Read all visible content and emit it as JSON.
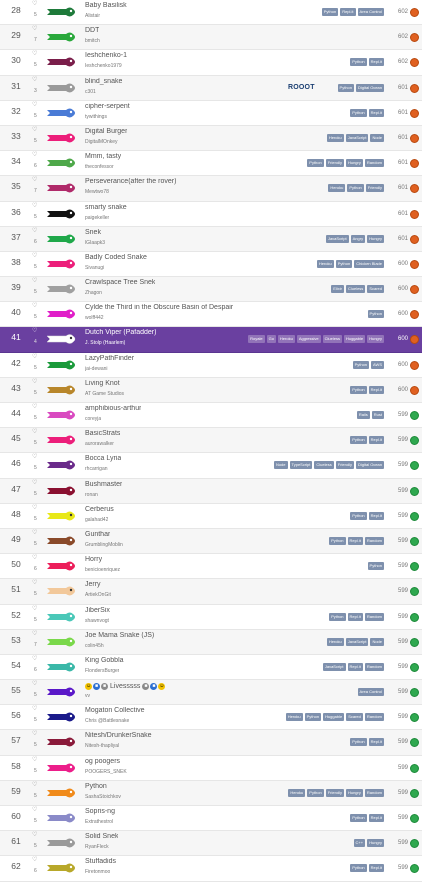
{
  "rows": [
    {
      "rank": "28",
      "hearts": "5",
      "name": "Baby Basilisk",
      "author": "Alistair",
      "tags": [
        "Python",
        "Repl.it",
        "Area Control"
      ],
      "score": "602",
      "badge": "bronze",
      "color": "#1e7a3a"
    },
    {
      "rank": "29",
      "hearts": "7",
      "name": "DDT",
      "author": "bmitch",
      "tags": [],
      "score": "602",
      "badge": "bronze",
      "color": "#29a83b"
    },
    {
      "rank": "30",
      "hearts": "5",
      "name": "Ieshchenko-1",
      "author": "Ieshchenko1979",
      "tags": [
        "Python",
        "Repl.it"
      ],
      "score": "602",
      "badge": "bronze",
      "color": "#7a1e4a"
    },
    {
      "rank": "31",
      "hearts": "3",
      "name": "blind_snake",
      "author": "c301",
      "tags": [
        "Python",
        "Digital Ocean"
      ],
      "score": "601",
      "badge": "bronze",
      "color": "#9a9a9a",
      "logo": "ROOOT"
    },
    {
      "rank": "32",
      "hearts": "5",
      "name": "cipher-serpent",
      "author": "tywithings",
      "tags": [
        "Python",
        "Repl.it"
      ],
      "score": "601",
      "badge": "bronze",
      "color": "#4a7bd6"
    },
    {
      "rank": "33",
      "hearts": "5",
      "name": "Digital Burger",
      "author": "DigitalMOnkey",
      "tags": [
        "Heroku",
        "JavaScript",
        "Node"
      ],
      "score": "601",
      "badge": "bronze",
      "color": "#ec1e7a"
    },
    {
      "rank": "34",
      "hearts": "6",
      "name": "Mmm, tasty",
      "author": "theconfessor",
      "tags": [
        "Python",
        "Friendly",
        "Hungry",
        "Random"
      ],
      "score": "601",
      "badge": "bronze",
      "color": "#4ea84a"
    },
    {
      "rank": "35",
      "hearts": "7",
      "name": "Perseverance(after the rover)",
      "author": "Mewtwo78",
      "tags": [
        "Heroku",
        "Python",
        "Friendly"
      ],
      "score": "601",
      "badge": "bronze",
      "color": "#b02a6a"
    },
    {
      "rank": "36",
      "hearts": "5",
      "name": "smarty snake",
      "author": "paigekeller",
      "tags": [],
      "score": "601",
      "badge": "bronze",
      "color": "#111111"
    },
    {
      "rank": "37",
      "hearts": "6",
      "name": "Snek",
      "author": "lGIaapk3",
      "tags": [
        "JavaScript",
        "Angry",
        "Hungry"
      ],
      "score": "601",
      "badge": "bronze",
      "color": "#1fa84a"
    },
    {
      "rank": "38",
      "hearts": "5",
      "name": "Badly Coded Snake",
      "author": "Sivanugi",
      "tags": [
        "Heroku",
        "Python",
        "Chicken Blade"
      ],
      "score": "600",
      "badge": "bronze",
      "color": "#ec1e7a"
    },
    {
      "rank": "39",
      "hearts": "5",
      "name": "Crawlspace Tree Snek",
      "author": "Zhagon",
      "tags": [
        "Elixir",
        "Clueless",
        "Scared"
      ],
      "score": "600",
      "badge": "bronze",
      "color": "#a0a0a0"
    },
    {
      "rank": "40",
      "hearts": "5",
      "name": "Cylde the Third in the Obscure Basin of Despair",
      "author": "wolff442",
      "tags": [
        "Python"
      ],
      "score": "600",
      "badge": "bronze",
      "color": "#e01ec8"
    },
    {
      "rank": "41",
      "hearts": "4",
      "name": "Dutch Viper (Pafadder)",
      "author": "J. Stolp (Haarlem)",
      "tags": [
        "Royale",
        "Go",
        "Heroku",
        "Aggressive",
        "Clueless",
        "Huggable",
        "Hungry"
      ],
      "score": "600",
      "badge": "bronze",
      "color": "#ffffff",
      "highlight": true
    },
    {
      "rank": "42",
      "hearts": "5",
      "name": "LazyPathFinder",
      "author": "jai-dewani",
      "tags": [
        "Python",
        "AWS"
      ],
      "score": "600",
      "badge": "bronze",
      "color": "#1a9a3a"
    },
    {
      "rank": "43",
      "hearts": "5",
      "name": "Living Knot",
      "author": "AT Game Studios",
      "tags": [
        "Python",
        "Repl.it"
      ],
      "score": "600",
      "badge": "bronze",
      "color": "#b8862a"
    },
    {
      "rank": "44",
      "hearts": "5",
      "name": "amphibious-arthur",
      "author": "coreyja",
      "tags": [
        "Rails",
        "Rust"
      ],
      "score": "599",
      "badge": "green",
      "color": "#d94ac0"
    },
    {
      "rank": "45",
      "hearts": "5",
      "name": "BasicStrats",
      "author": "aurorawalker",
      "tags": [
        "Python",
        "Repl.it"
      ],
      "score": "599",
      "badge": "green",
      "color": "#ec1e7a"
    },
    {
      "rank": "46",
      "hearts": "5",
      "name": "Bocca Lyria",
      "author": "rhcarrigan",
      "tags": [
        "Node",
        "TypeScript",
        "Clueless",
        "Friendly",
        "Digital Ocean"
      ],
      "score": "599",
      "badge": "green",
      "color": "#6a2a8a"
    },
    {
      "rank": "47",
      "hearts": "5",
      "name": "Bushmaster",
      "author": "ronan",
      "tags": [],
      "score": "599",
      "badge": "green",
      "color": "#8a1030"
    },
    {
      "rank": "48",
      "hearts": "5",
      "name": "Cerberus",
      "author": "galahad42",
      "tags": [
        "Python",
        "Repl.it"
      ],
      "score": "599",
      "badge": "green",
      "color": "#e8e818"
    },
    {
      "rank": "49",
      "hearts": "5",
      "name": "Gunthar",
      "author": "GrumblingMoblin",
      "tags": [
        "Python",
        "Repl.it",
        "Random"
      ],
      "score": "599",
      "badge": "green",
      "color": "#8a4a2a"
    },
    {
      "rank": "50",
      "hearts": "6",
      "name": "Horry",
      "author": "benicioenriquez",
      "tags": [
        "Python"
      ],
      "score": "599",
      "badge": "green",
      "color": "#ec1e5a"
    },
    {
      "rank": "51",
      "hearts": "5",
      "name": "Jerry",
      "author": "ArtiekOnGit",
      "tags": [],
      "score": "599",
      "badge": "green",
      "color": "#f2c89a"
    },
    {
      "rank": "52",
      "hearts": "5",
      "name": "JiberSix",
      "author": "shawnvogt",
      "tags": [
        "Python",
        "Repl.it",
        "Random"
      ],
      "score": "599",
      "badge": "green",
      "color": "#4ac8b8"
    },
    {
      "rank": "53",
      "hearts": "7",
      "name": "Joe Mama Snake (JS)",
      "author": "colin45h",
      "tags": [
        "Heroku",
        "JavaScript",
        "Node"
      ],
      "score": "599",
      "badge": "green",
      "color": "#7ad84a"
    },
    {
      "rank": "54",
      "hearts": "6",
      "name": "King Gobbla",
      "author": "FlondersBurger",
      "tags": [
        "JavaScript",
        "Repl.it",
        "Random"
      ],
      "score": "599",
      "badge": "green",
      "color": "#3ab8a8"
    },
    {
      "rank": "55",
      "hearts": "5",
      "name": "Livesssss",
      "author": "vv",
      "tags": [
        "Area Control"
      ],
      "score": "599",
      "badge": "green",
      "color": "#5a18c8",
      "special": true
    },
    {
      "rank": "56",
      "hearts": "5",
      "name": "Mogaton Collective",
      "author": "Chris @Battlesnake",
      "tags": [
        "Heroku",
        "Python",
        "Huggable",
        "Scared",
        "Random"
      ],
      "score": "599",
      "badge": "green",
      "color": "#1a1a8a"
    },
    {
      "rank": "57",
      "hearts": "5",
      "name": "Nitesh/DrunkerSnake",
      "author": "Nitesh-thapliyal",
      "tags": [
        "Python",
        "Repl.it"
      ],
      "score": "599",
      "badge": "green",
      "color": "#8a1a3a"
    },
    {
      "rank": "58",
      "hearts": "5",
      "name": "og poogers",
      "author": "POOGERS_SNEK",
      "tags": [],
      "score": "599",
      "badge": "green",
      "color": "#ec1e8a"
    },
    {
      "rank": "59",
      "hearts": "5",
      "name": "Python",
      "author": "SashaStoichkov",
      "tags": [
        "Heroku",
        "Python",
        "Friendly",
        "Hungry",
        "Random"
      ],
      "score": "599",
      "badge": "green",
      "color": "#f08a1a"
    },
    {
      "rank": "60",
      "hearts": "5",
      "name": "Sopris-ng",
      "author": "Extrathestrol",
      "tags": [
        "Python",
        "Repl.it"
      ],
      "score": "599",
      "badge": "green",
      "color": "#8a8ac8"
    },
    {
      "rank": "61",
      "hearts": "5",
      "name": "Solid Snek",
      "author": "RyanFleck",
      "tags": [
        "C++",
        "Hungry"
      ],
      "score": "599",
      "badge": "green",
      "color": "#9a9a9a"
    },
    {
      "rank": "62",
      "hearts": "6",
      "name": "Stuffadids",
      "author": "Firetonmoo",
      "tags": [
        "Python",
        "Repl.it"
      ],
      "score": "599",
      "badge": "green",
      "color": "#b8a82a"
    }
  ],
  "icons": {
    "heart": "heart-icon",
    "badge_bronze": "bronze-medal-icon",
    "badge_green": "green-medal-icon"
  },
  "colors": {
    "highlight": "#6a40a0",
    "tag": "#7e90ad",
    "row_alt": "#f6f6f6"
  }
}
